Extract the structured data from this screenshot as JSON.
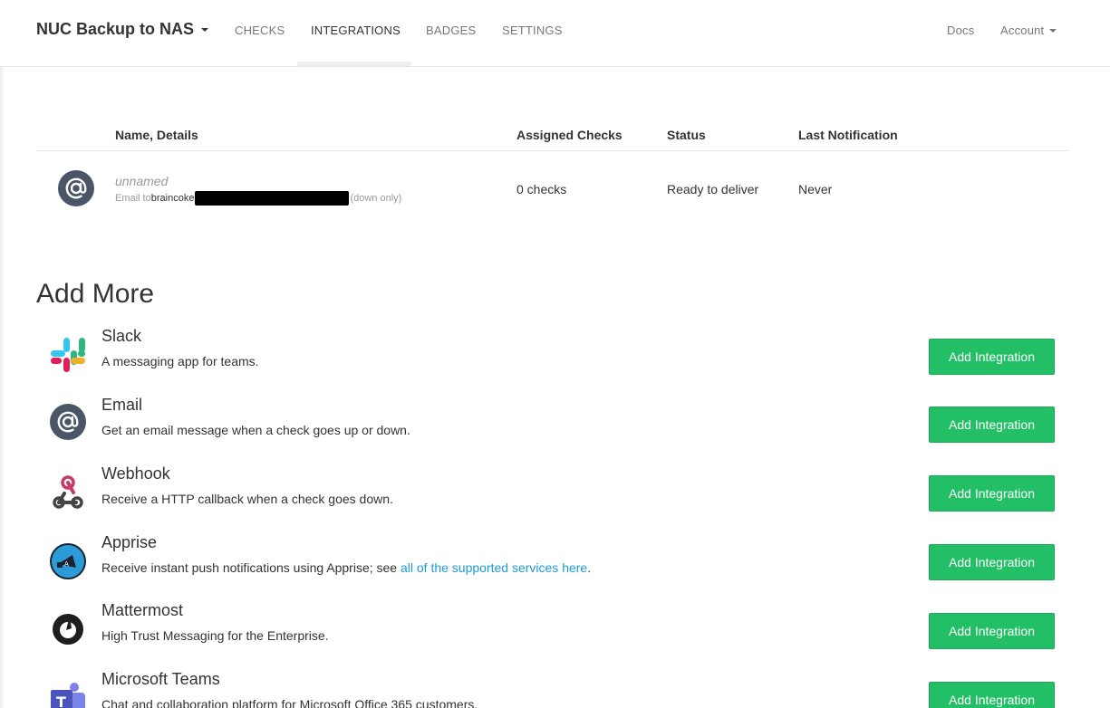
{
  "navbar": {
    "brand": "NUC Backup to NAS",
    "links": [
      "CHECKS",
      "INTEGRATIONS",
      "BADGES",
      "SETTINGS"
    ],
    "docs": "Docs",
    "account": "Account"
  },
  "table": {
    "headers": [
      "Name, Details",
      "Assigned Checks",
      "Status",
      "Last Notification"
    ],
    "rows": [
      {
        "name": "unnamed",
        "email_prefix": "Email to ",
        "email_addr": "braincoke",
        "email_suffix": "(down only)",
        "checks": "0 checks",
        "status": "Ready to deliver",
        "last": "Never"
      }
    ]
  },
  "add_more": {
    "title": "Add More",
    "button_label": "Add Integration",
    "items": [
      {
        "name": "Slack",
        "desc": "A messaging app for teams.",
        "icon": "slack-icon"
      },
      {
        "name": "Email",
        "desc": "Get an email message when a check goes up or down.",
        "icon": "email-icon"
      },
      {
        "name": "Webhook",
        "desc": "Receive a HTTP callback when a check goes down.",
        "icon": "webhook-icon"
      },
      {
        "name": "Apprise",
        "desc": "Receive instant push notifications using Apprise; see ",
        "link": "all of the supported services here",
        "desc_end": ".",
        "icon": "apprise-icon"
      },
      {
        "name": "Mattermost",
        "desc": "High Trust Messaging for the Enterprise.",
        "icon": "mattermost-icon"
      },
      {
        "name": "Microsoft Teams",
        "desc": "Chat and collaboration platform for Microsoft Office 365 customers.",
        "icon": "teams-icon"
      }
    ]
  },
  "colors": {
    "accent_green": "#22bf66",
    "link_blue": "#1a9bd7",
    "icon_slate": "#4a5565"
  }
}
